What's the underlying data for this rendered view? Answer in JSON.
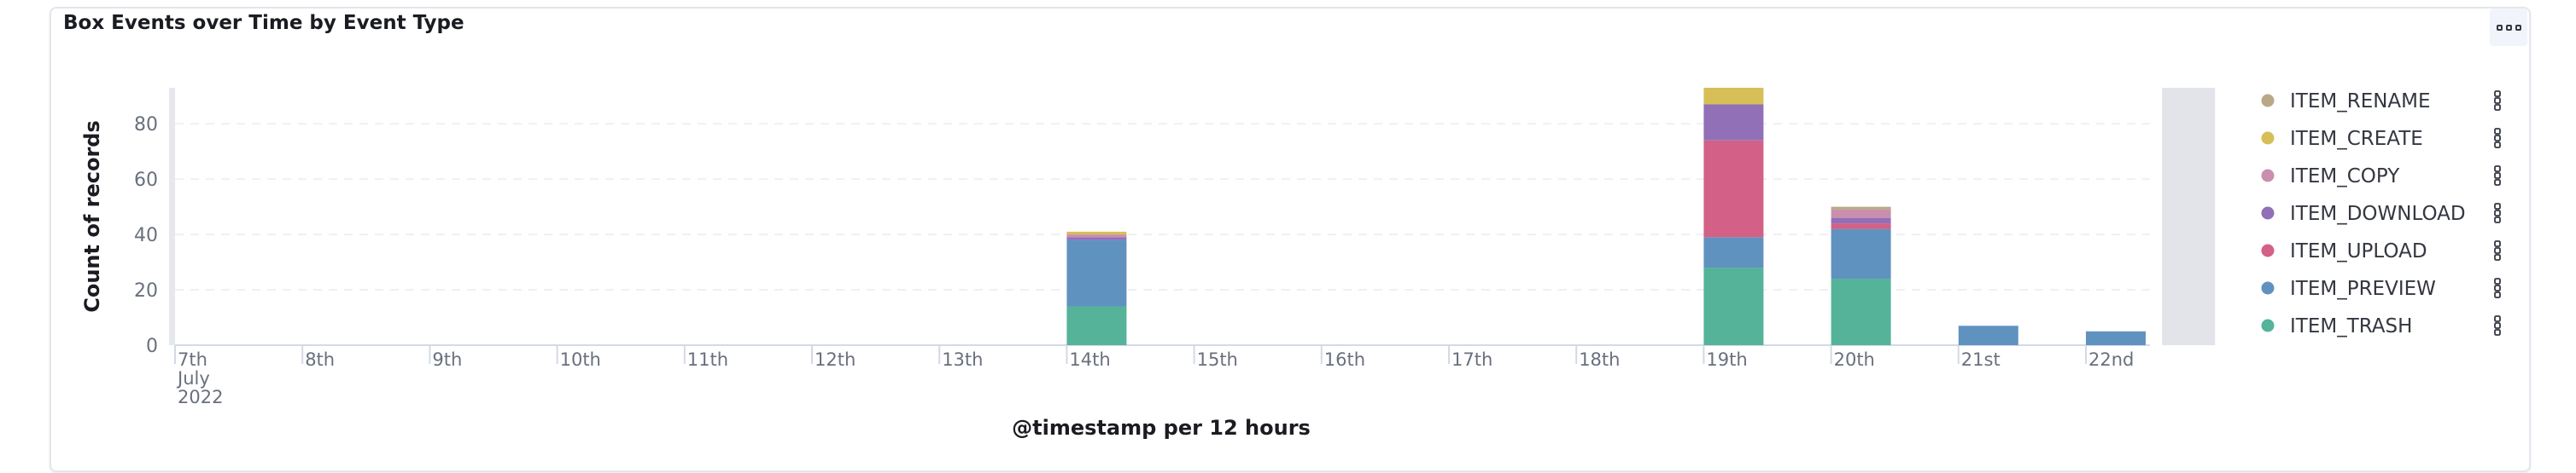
{
  "panel": {
    "title": "Box Events over Time by Event Type",
    "options_icon": "panel-options-icon"
  },
  "chart_data": {
    "type": "bar",
    "stacked": true,
    "title": "Box Events over Time by Event Type",
    "xlabel": "@timestamp per 12 hours",
    "ylabel": "Count of records",
    "ylim": [
      0,
      93
    ],
    "yticks": [
      0,
      20,
      40,
      60,
      80
    ],
    "grid": true,
    "legend_position": "right",
    "x_tick_labels": [
      "7th",
      "8th",
      "9th",
      "10th",
      "11th",
      "12th",
      "13th",
      "14th",
      "15th",
      "16th",
      "17th",
      "18th",
      "19th",
      "20th",
      "21st",
      "22nd"
    ],
    "x_tick_sub_labels": [
      "July",
      "2022"
    ],
    "categories": [
      "Jul 14 00:00",
      "Jul 19 00:00",
      "Jul 20 00:00",
      "Jul 21 00:00",
      "Jul 22 00:00"
    ],
    "series": [
      {
        "name": "ITEM_TRASH",
        "color": "#54b399",
        "values": [
          14,
          28,
          24,
          0,
          0
        ]
      },
      {
        "name": "ITEM_PREVIEW",
        "color": "#6092c0",
        "values": [
          24,
          11,
          18,
          7,
          5
        ]
      },
      {
        "name": "ITEM_UPLOAD",
        "color": "#d36086",
        "values": [
          0,
          35,
          2,
          0,
          0
        ]
      },
      {
        "name": "ITEM_DOWNLOAD",
        "color": "#9170b8",
        "values": [
          1,
          13,
          2,
          0,
          0
        ]
      },
      {
        "name": "ITEM_COPY",
        "color": "#ca8eae",
        "values": [
          1,
          0,
          3,
          0,
          0
        ]
      },
      {
        "name": "ITEM_CREATE",
        "color": "#d6bf57",
        "values": [
          1,
          6,
          0,
          0,
          0
        ]
      },
      {
        "name": "ITEM_RENAME",
        "color": "#b9a888",
        "values": [
          0,
          0,
          1,
          0,
          0
        ]
      }
    ],
    "legend_order": [
      "ITEM_RENAME",
      "ITEM_CREATE",
      "ITEM_COPY",
      "ITEM_DOWNLOAD",
      "ITEM_UPLOAD",
      "ITEM_PREVIEW",
      "ITEM_TRASH"
    ]
  }
}
